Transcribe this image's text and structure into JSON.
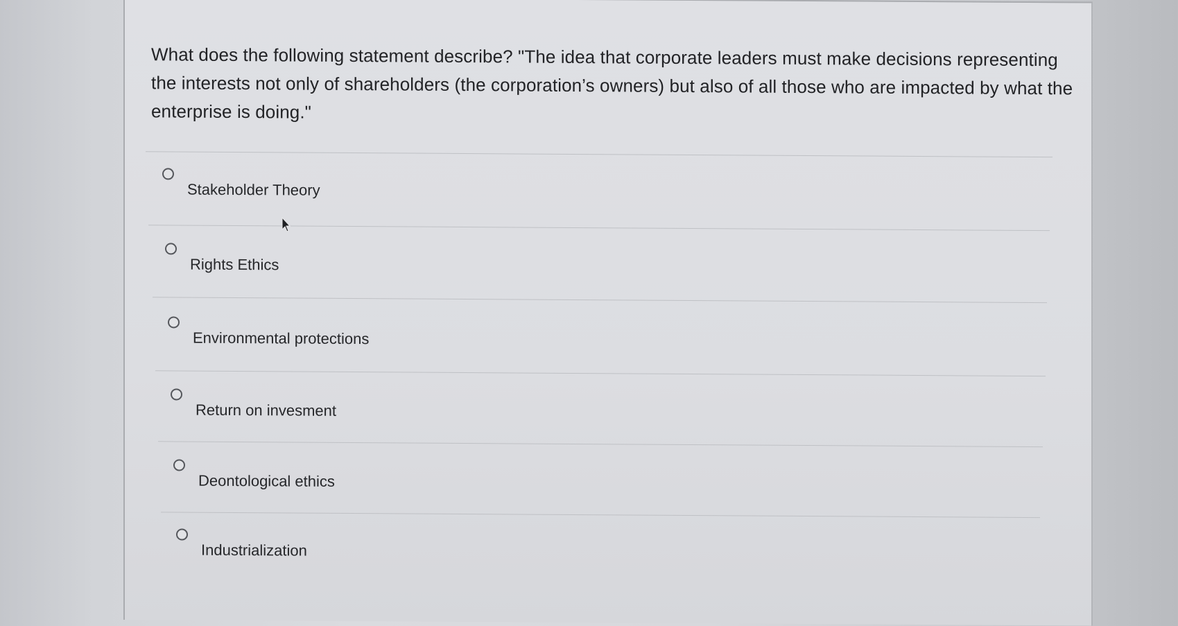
{
  "question": {
    "text": "What does the following statement describe? \"The idea that corporate leaders must make decisions representing the interests not only of shareholders (the corporation’s owners) but also of all those who are impacted by what the enterprise is doing.\""
  },
  "options": [
    {
      "label": "Stakeholder Theory",
      "selected": false
    },
    {
      "label": "Rights Ethics",
      "selected": false
    },
    {
      "label": "Environmental protections",
      "selected": false
    },
    {
      "label": "Return on invesment",
      "selected": false
    },
    {
      "label": "Deontological ethics",
      "selected": false
    },
    {
      "label": "Industrialization",
      "selected": false
    }
  ],
  "icons": {
    "radio": "radio-button-icon",
    "cursor": "mouse-pointer-icon"
  },
  "colors": {
    "text": "#222326",
    "divider": "#bfc1c5",
    "radio_border": "#55575c"
  }
}
